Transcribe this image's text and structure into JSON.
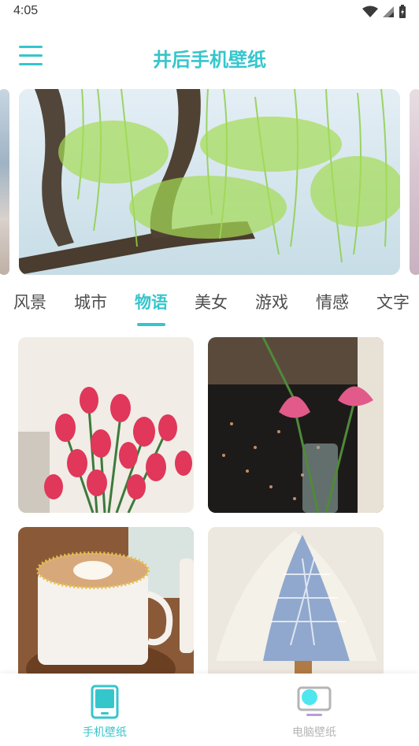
{
  "status": {
    "time": "4:05"
  },
  "header": {
    "title": "井后手机壁纸"
  },
  "tabs": [
    {
      "label": "风景",
      "active": false
    },
    {
      "label": "城市",
      "active": false
    },
    {
      "label": "物语",
      "active": true
    },
    {
      "label": "美女",
      "active": false
    },
    {
      "label": "游戏",
      "active": false
    },
    {
      "label": "情感",
      "active": false
    },
    {
      "label": "文字",
      "active": false
    }
  ],
  "bottom_nav": [
    {
      "label": "手机壁纸",
      "active": true
    },
    {
      "label": "电脑壁纸",
      "active": false
    }
  ],
  "colors": {
    "accent": "#35c6cc",
    "inactive": "#4d4d4d",
    "nav_inactive": "#b5b5b5",
    "nav_icon_inactive": "#b79be0"
  }
}
